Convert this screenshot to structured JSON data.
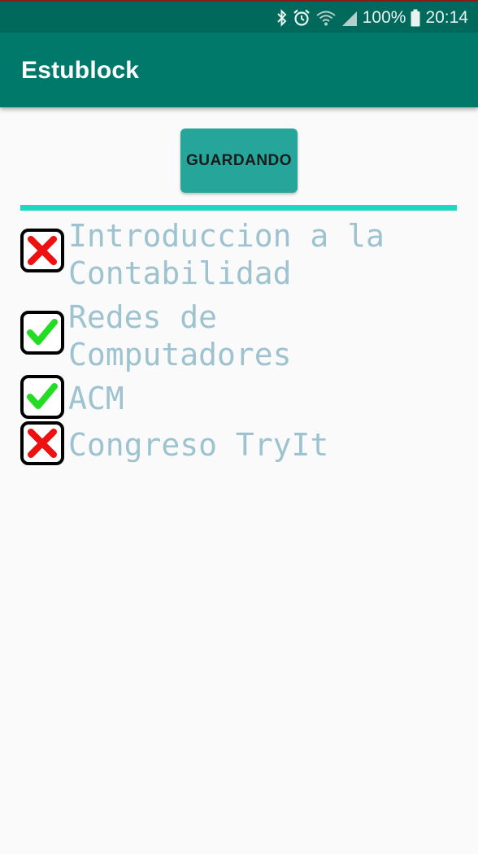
{
  "status_bar": {
    "battery_percent": "100%",
    "time": "20:14",
    "icons": [
      "bluetooth-icon",
      "alarm-icon",
      "wifi-icon",
      "signal-icon",
      "battery-icon"
    ]
  },
  "app_bar": {
    "title": "Estublock"
  },
  "save_button": {
    "label": "GUARDANDO"
  },
  "tasks": [
    {
      "label": "Introduccion a la Contabilidad",
      "status": "cross"
    },
    {
      "label": "Redes de Computadores",
      "status": "check"
    },
    {
      "label": "ACM",
      "status": "check"
    },
    {
      "label": "Congreso TryIt",
      "status": "cross"
    }
  ],
  "colors": {
    "status_bar": "#00695c",
    "app_bar": "#00796b",
    "button": "#26a69a",
    "divider": "#1ed6c4",
    "task_text": "#9ec3d0",
    "check": "#22dd22",
    "cross": "#ee1111"
  }
}
